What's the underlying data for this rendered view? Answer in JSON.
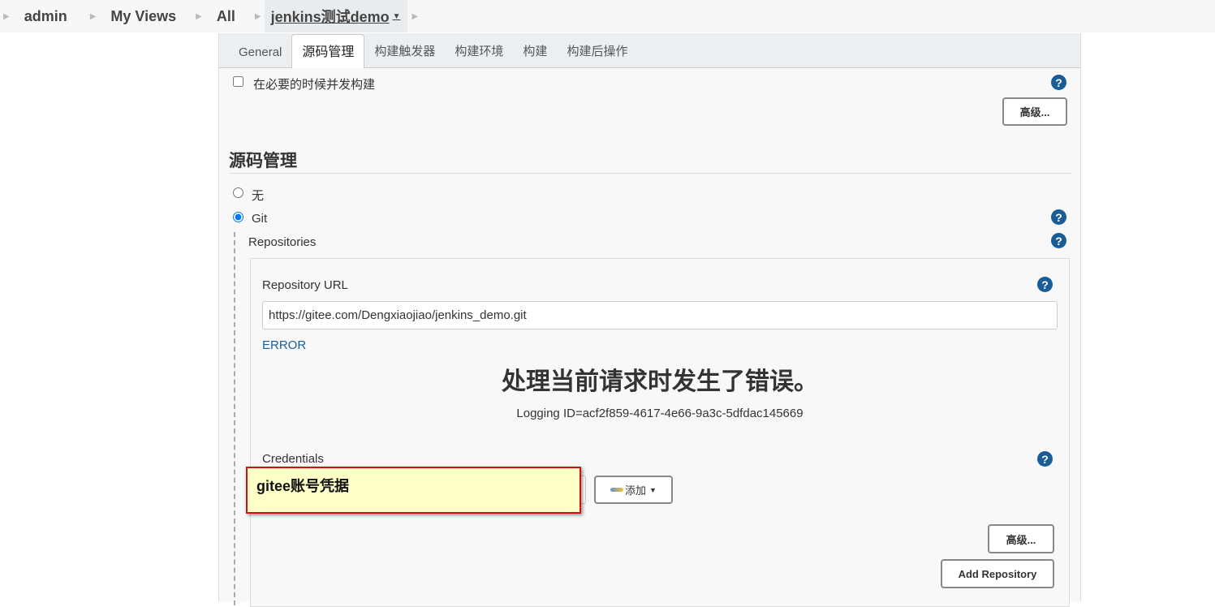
{
  "breadcrumb": [
    "admin",
    "My Views",
    "All",
    "jenkins测试demo"
  ],
  "tabs": [
    "General",
    "源码管理",
    "构建触发器",
    "构建环境",
    "构建",
    "构建后操作"
  ],
  "concurrent_label": "在必要的时候并发构建",
  "advanced_label": "高级...",
  "section_title": "源码管理",
  "scm_options": {
    "none": "无",
    "git": "Git",
    "selected": "Git"
  },
  "repositories_label": "Repositories",
  "repo_url_label": "Repository URL",
  "repo_url_value": "https://gitee.com/Dengxiaojiao/jenkins_demo.git",
  "error_label": "ERROR",
  "error_title": "处理当前请求时发生了错误。",
  "logging_id": "Logging ID=acf2f859-4617-4e66-9a3c-5dfdac145669",
  "credentials_label": "Credentials",
  "annotation": "gitee账号凭据",
  "add_label": "添加",
  "add_repository_label": "Add Repository",
  "help_glyph": "?",
  "colors": {
    "help": "#1a5d96",
    "error": "#1a5d96",
    "annotation_bg": "#ffffc8",
    "annotation_border": "#cc1111"
  }
}
